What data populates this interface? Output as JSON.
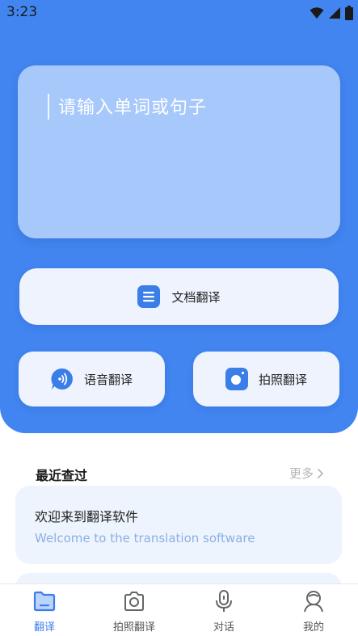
{
  "status_bar": {
    "time": "3:23"
  },
  "translate_input": {
    "placeholder": "请输入单词或句子"
  },
  "actions": {
    "document_label": "文档翻译",
    "voice_label": "语音翻译",
    "photo_label": "拍照翻译"
  },
  "recent": {
    "title": "最近查过",
    "more_label": "更多",
    "items": [
      {
        "source": "欢迎来到翻译软件",
        "translation": "Welcome to the translation software"
      }
    ]
  },
  "tabbar": {
    "tabs": [
      {
        "label": "翻译",
        "icon": "folder-icon",
        "active": true
      },
      {
        "label": "拍照翻译",
        "icon": "camera-icon",
        "active": false
      },
      {
        "label": "对话",
        "icon": "microphone-icon",
        "active": false
      },
      {
        "label": "我的",
        "icon": "person-icon",
        "active": false
      }
    ]
  },
  "colors": {
    "primary": "#4285f0",
    "input_card": "#a7c8fb",
    "button_bg": "#eef3fd",
    "card_bg": "#eef4fd",
    "active_tab": "#3b7cf0"
  }
}
